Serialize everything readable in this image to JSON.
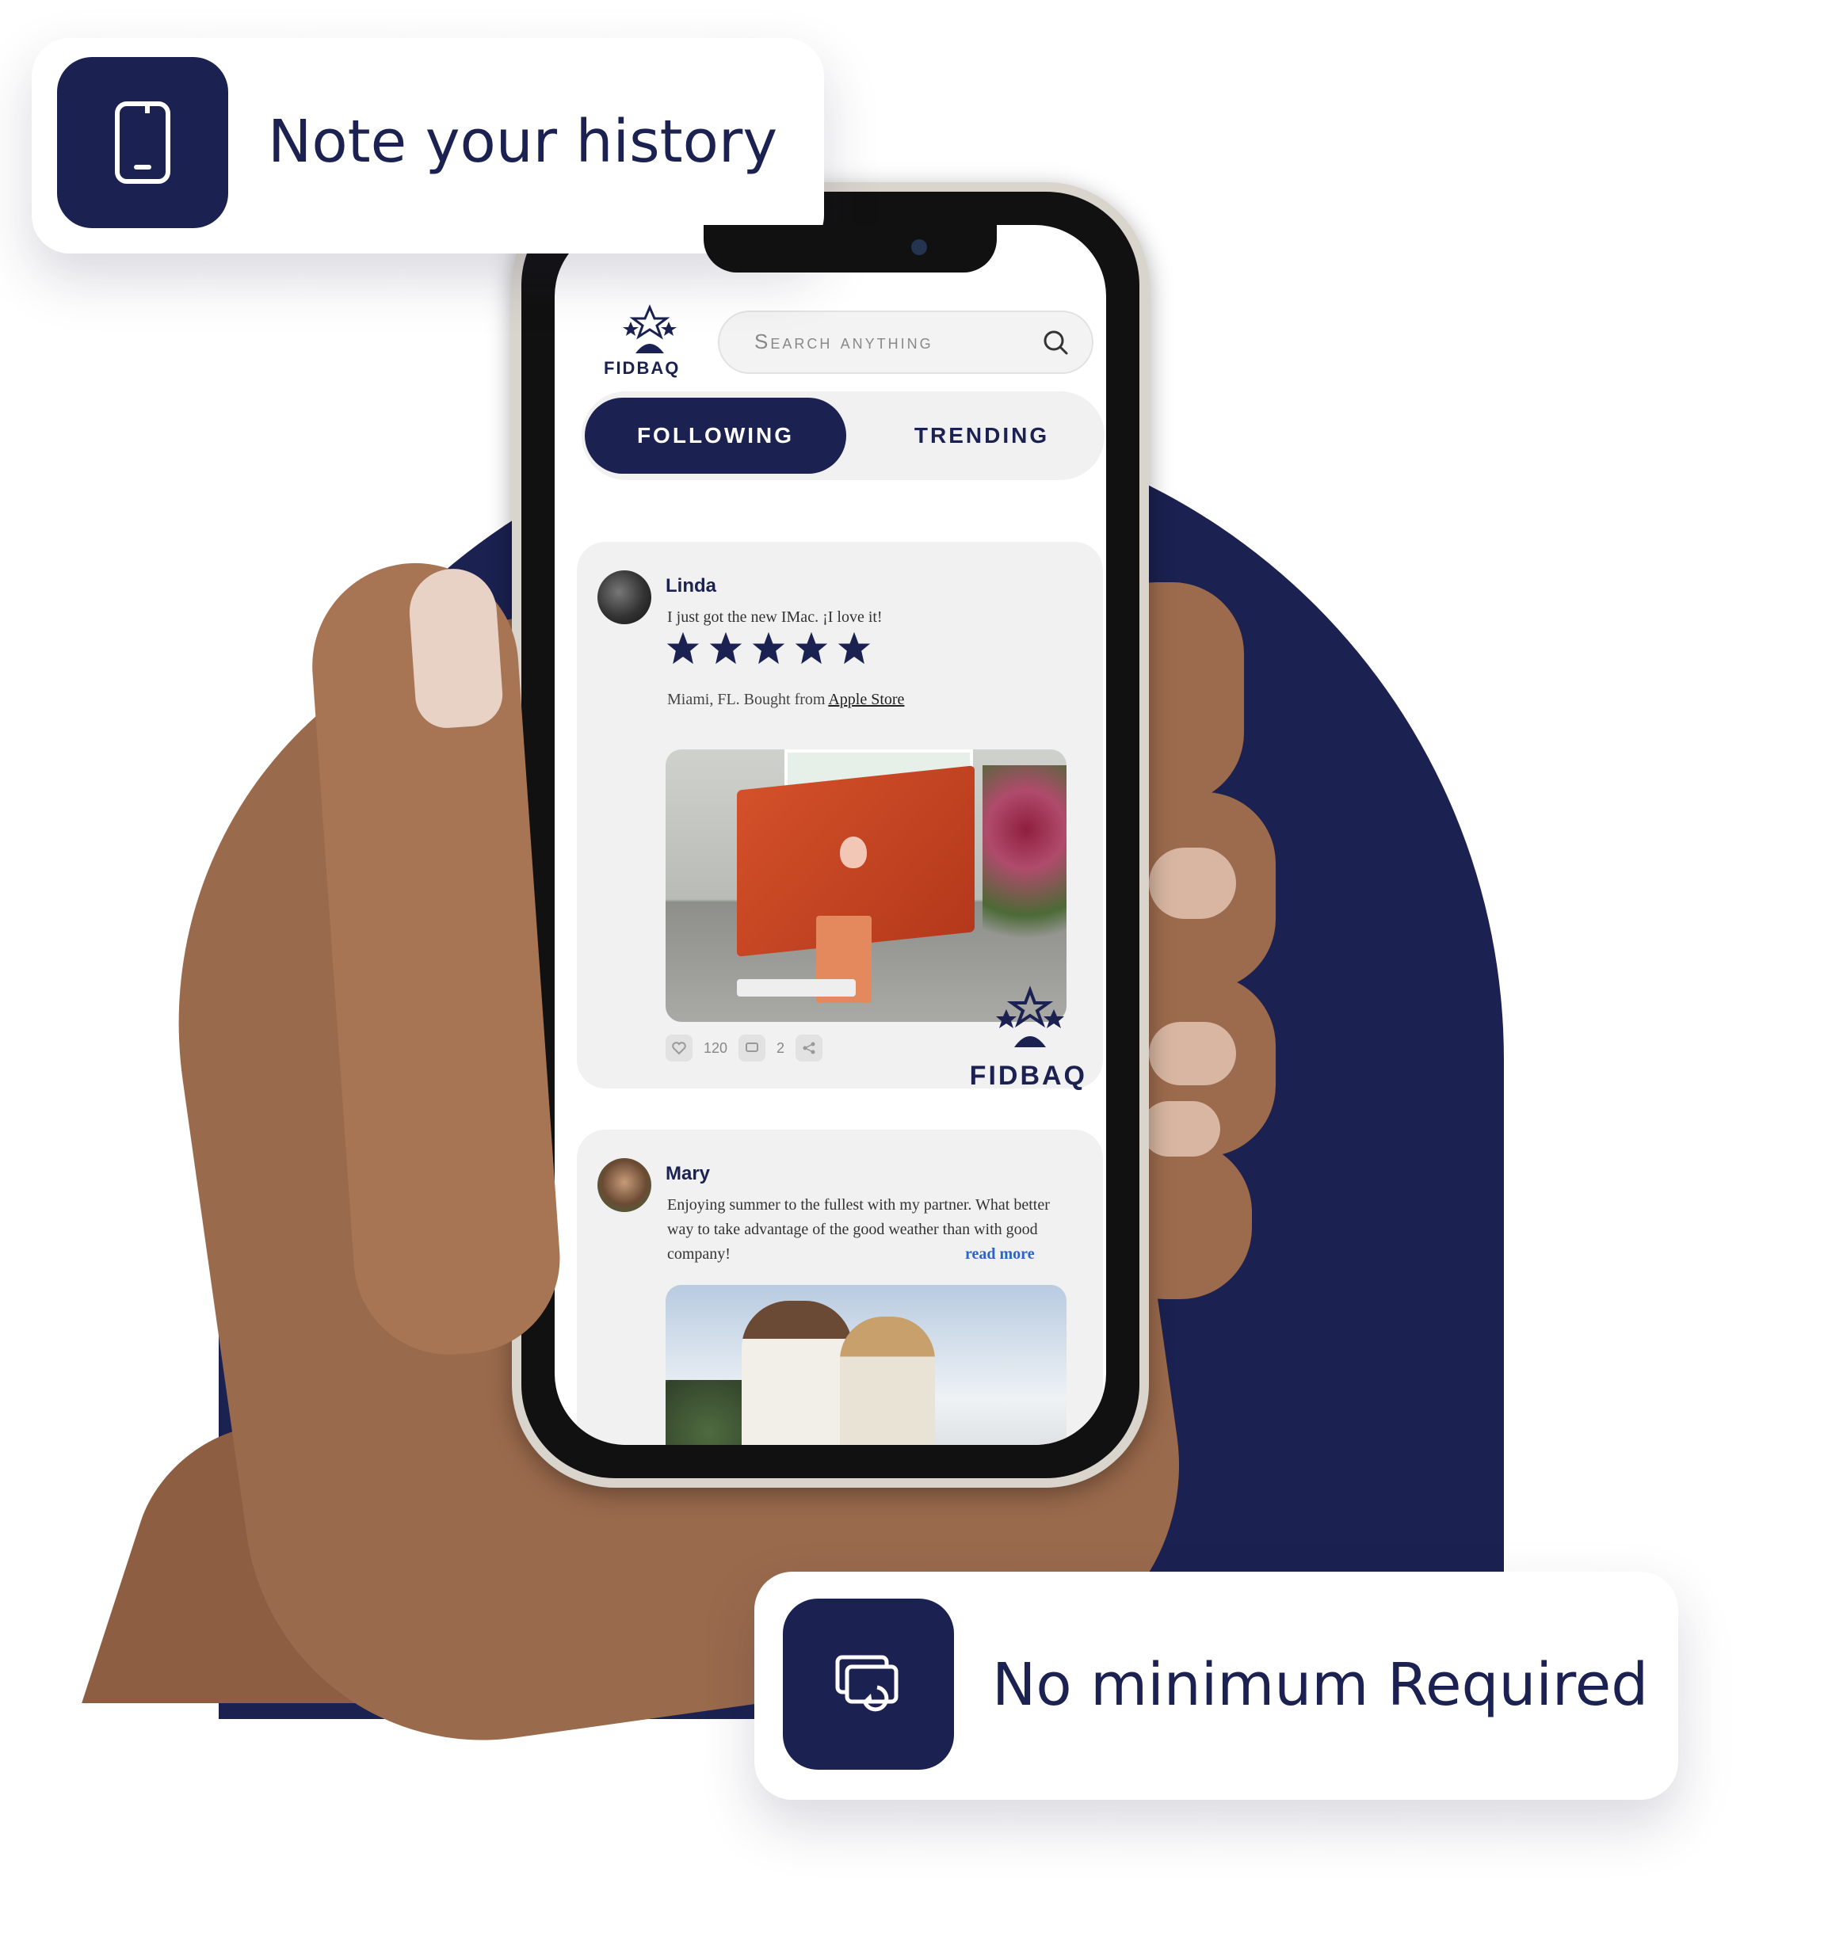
{
  "callouts": {
    "history": {
      "label": "Note your history",
      "icon": "smartphone-icon"
    },
    "minimum": {
      "label": "No minimum Required",
      "icon": "cards-cash-icon"
    }
  },
  "app": {
    "brand": "FIDBAQ",
    "search_placeholder": "Search anything",
    "tabs": {
      "following": "FOLLOWING",
      "trending": "TRENDING",
      "active": "following"
    }
  },
  "posts": [
    {
      "author": "Linda",
      "text": "I just got the new IMac. ¡I love it!",
      "rating": 5,
      "location_prefix": "Miami, FL. Bought from ",
      "store": "Apple Store",
      "likes": "120",
      "comments": "2"
    },
    {
      "author": "Mary",
      "text": "Enjoying summer to the fullest with my partner. What better way to take advantage of the good weather than with good company!",
      "read_more": "read more"
    }
  ],
  "colors": {
    "navy": "#1b2150",
    "link": "#2d62c9"
  }
}
